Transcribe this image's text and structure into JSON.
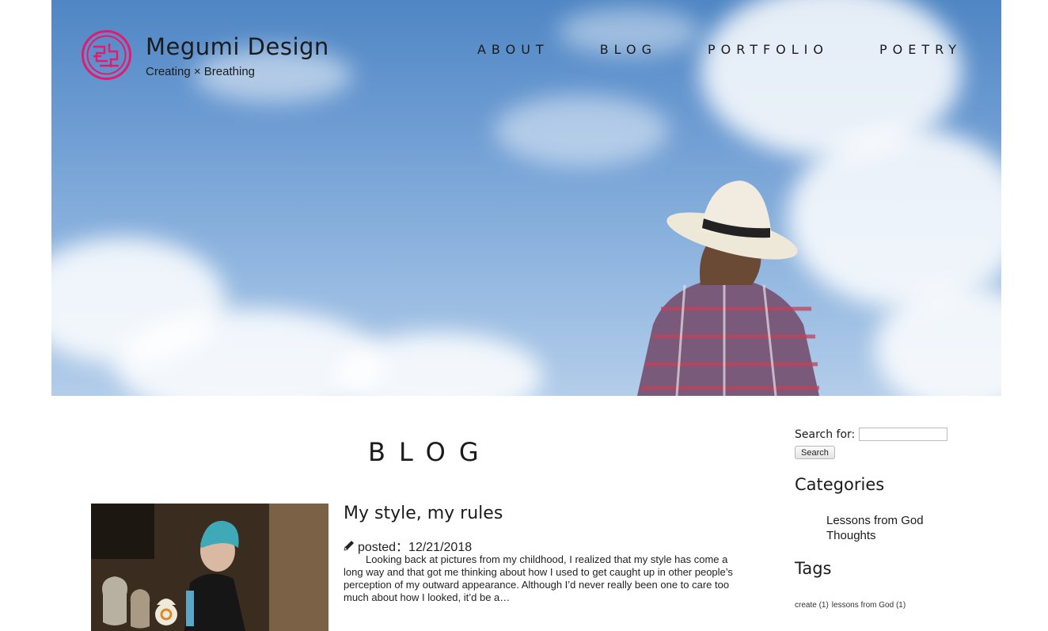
{
  "colors": {
    "logo_accent": "#e8186e",
    "text": "#1b1b1b"
  },
  "header": {
    "brand_name": "Megumi Design",
    "tagline": "Creating × Breathing",
    "logo_icon": "maze-seal-icon",
    "nav": [
      {
        "label": "ABOUT"
      },
      {
        "label": "BLOG"
      },
      {
        "label": "PORTFOLIO"
      },
      {
        "label": "POETRY"
      }
    ]
  },
  "page": {
    "title": "BLOG"
  },
  "post": {
    "title": "My style, my rules",
    "meta_icon": "pencil-icon",
    "posted_label": "posted：12/21/2018",
    "excerpt": "Looking back at pictures from my childhood, I realized that my style has come a long way and that got me thinking about how I used to get caught up in other people’s perception of my outward appearance. Although I’d never really been one to care too much about how I looked, it’d be a…"
  },
  "sidebar": {
    "search_label": "Search for:",
    "search_value": "",
    "search_button": "Search",
    "categories_title": "Categories",
    "categories": [
      {
        "label": "Lessons from God"
      },
      {
        "label": "Thoughts"
      }
    ],
    "tags_title": "Tags",
    "tags": [
      {
        "label": "create (1)"
      },
      {
        "label": "lessons from God (1)"
      }
    ]
  }
}
